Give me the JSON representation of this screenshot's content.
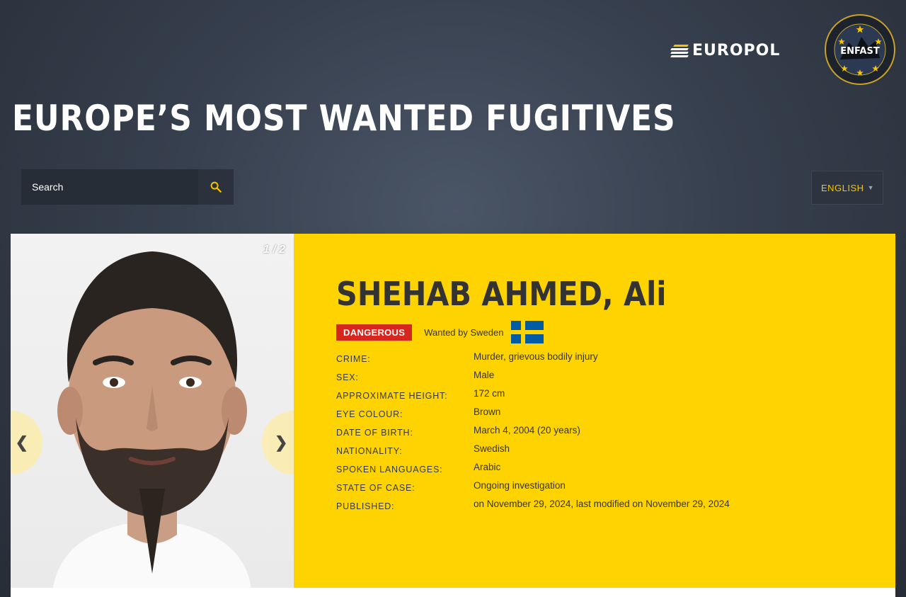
{
  "header": {
    "europol_logo_text": "EUROPOL",
    "enfast_logo_text": "ENFAST",
    "title": "EUROPE’S MOST WANTED FUGITIVES"
  },
  "search": {
    "placeholder": "Search"
  },
  "language": {
    "selected": "ENGLISH"
  },
  "photo": {
    "counter": "1 / 2",
    "prev_label": "❮",
    "next_label": "❯"
  },
  "fugitive": {
    "name": "SHEHAB AHMED, Ali",
    "status_badge": "DANGEROUS",
    "wanted_by": "Wanted by Sweden",
    "details": [
      {
        "label": "CRIME:",
        "value": "Murder, grievous bodily injury"
      },
      {
        "label": "SEX:",
        "value": "Male"
      },
      {
        "label": "APPROXIMATE HEIGHT:",
        "value": "172 cm"
      },
      {
        "label": "EYE COLOUR:",
        "value": "Brown"
      },
      {
        "label": "DATE OF BIRTH:",
        "value": "March 4, 2004 (20 years)"
      },
      {
        "label": "NATIONALITY:",
        "value": "Swedish"
      },
      {
        "label": "SPOKEN LANGUAGES:",
        "value": "Arabic"
      },
      {
        "label": "STATE OF CASE:",
        "value": "Ongoing investigation"
      },
      {
        "label": "PUBLISHED:",
        "value": "on November 29, 2024, last modified on November 29, 2024"
      }
    ]
  },
  "colors": {
    "accent_yellow": "#fed300",
    "danger_red": "#d7261e",
    "flag_blue": "#005da3"
  }
}
